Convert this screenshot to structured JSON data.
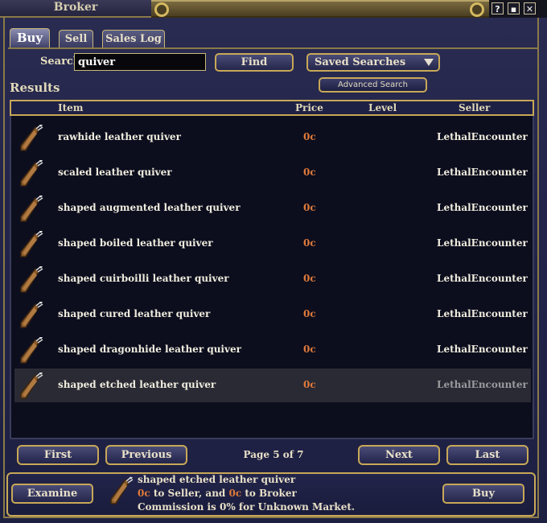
{
  "window": {
    "title": "Broker",
    "help_glyph": "?",
    "restore_glyph": "▪",
    "close_glyph": "✕"
  },
  "tabs": [
    {
      "label": "Buy",
      "active": true
    },
    {
      "label": "Sell",
      "active": false
    },
    {
      "label": "Sales Log",
      "active": false
    }
  ],
  "search": {
    "label": "Search",
    "value": "quiver",
    "find_label": "Find",
    "saved_searches_label": "Saved Searches",
    "advanced_label": "Advanced Search"
  },
  "results": {
    "label": "Results",
    "columns": [
      "Item",
      "Price",
      "Level",
      "Seller"
    ],
    "rows": [
      {
        "name": "rawhide leather quiver",
        "price": "0c",
        "level": "",
        "seller": "LethalEncounter"
      },
      {
        "name": "scaled leather quiver",
        "price": "0c",
        "level": "",
        "seller": "LethalEncounter"
      },
      {
        "name": "shaped augmented leather quiver",
        "price": "0c",
        "level": "",
        "seller": "LethalEncounter"
      },
      {
        "name": "shaped boiled leather quiver",
        "price": "0c",
        "level": "",
        "seller": "LethalEncounter"
      },
      {
        "name": "shaped cuirboilli leather quiver",
        "price": "0c",
        "level": "",
        "seller": "LethalEncounter"
      },
      {
        "name": "shaped cured leather quiver",
        "price": "0c",
        "level": "",
        "seller": "LethalEncounter"
      },
      {
        "name": "shaped dragonhide leather quiver",
        "price": "0c",
        "level": "",
        "seller": "LethalEncounter"
      },
      {
        "name": "shaped etched leather quiver",
        "price": "0c",
        "level": "",
        "seller": "LethalEncounter",
        "selected": true
      }
    ],
    "item_icon": "quiver-icon"
  },
  "pager": {
    "first": "First",
    "previous": "Previous",
    "page_info": "Page 5 of 7",
    "next": "Next",
    "last": "Last"
  },
  "footer": {
    "examine_label": "Examine",
    "buy_label": "Buy",
    "selected_name": "shaped etched leather quiver",
    "seller_amount": "0c",
    "seller_text": " to Seller, and ",
    "broker_amount": "0c",
    "broker_text": " to Broker",
    "commission": "Commission is 0% for Unknown Market."
  },
  "colors": {
    "price": "#e07a3a",
    "border_gold": "#c8a858",
    "panel": "#22244a"
  }
}
